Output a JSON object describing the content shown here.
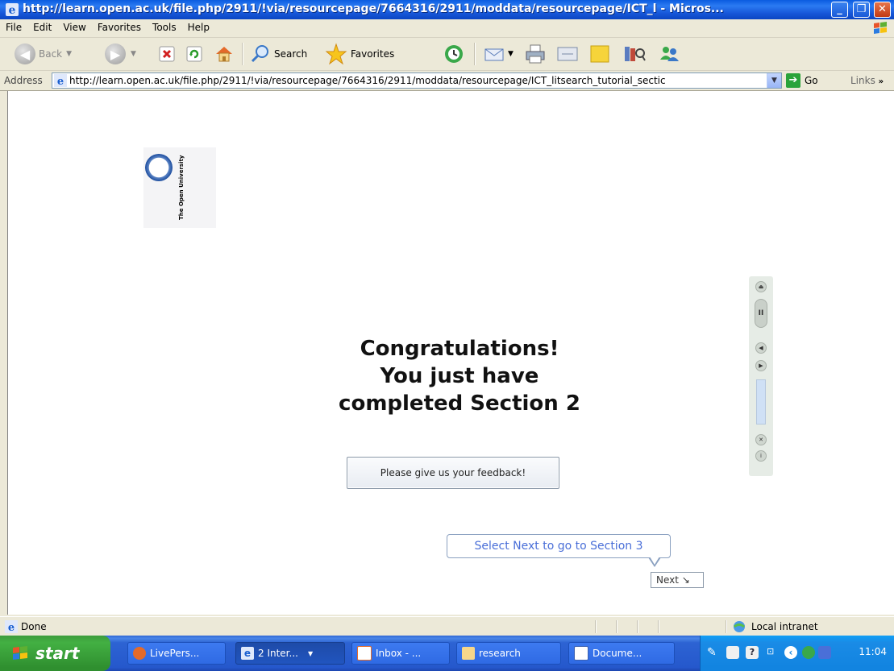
{
  "window": {
    "title": "http://learn.open.ac.uk/file.php/2911/!via/resourcepage/7664316/2911/moddata/resourcepage/ICT_l - Micros...",
    "min_label": "_",
    "max_label": "❐",
    "close_label": "✕"
  },
  "menu": {
    "items": [
      "File",
      "Edit",
      "View",
      "Favorites",
      "Tools",
      "Help"
    ]
  },
  "toolbar": {
    "back_label": "Back",
    "search_label": "Search",
    "favorites_label": "Favorites"
  },
  "address": {
    "label": "Address",
    "url": "http://learn.open.ac.uk/file.php/2911/!via/resourcepage/7664316/2911/moddata/resourcepage/ICT_litsearch_tutorial_sectic",
    "go_label": "Go",
    "links_label": "Links"
  },
  "page": {
    "logo_text": "The Open University",
    "congrats_line1": "Congratulations!",
    "congrats_line2": "You just have",
    "congrats_line3": "completed Section 2",
    "feedback_label": "Please give us your feedback!",
    "callout_text": "Select Next to go to Section 3",
    "next_label": "Next ↘"
  },
  "status": {
    "left": "Done",
    "zone": "Local intranet"
  },
  "taskbar": {
    "start_label": "start",
    "tasks": [
      "LivePers...",
      "2 Inter...",
      "Inbox - ...",
      "research",
      "Docume..."
    ],
    "clock": "11:04"
  },
  "colors": {
    "titlebar": "#0a5ce0",
    "taskbar": "#2558cc",
    "start": "#3c9d3c",
    "callout_text": "#4a6fd8"
  }
}
